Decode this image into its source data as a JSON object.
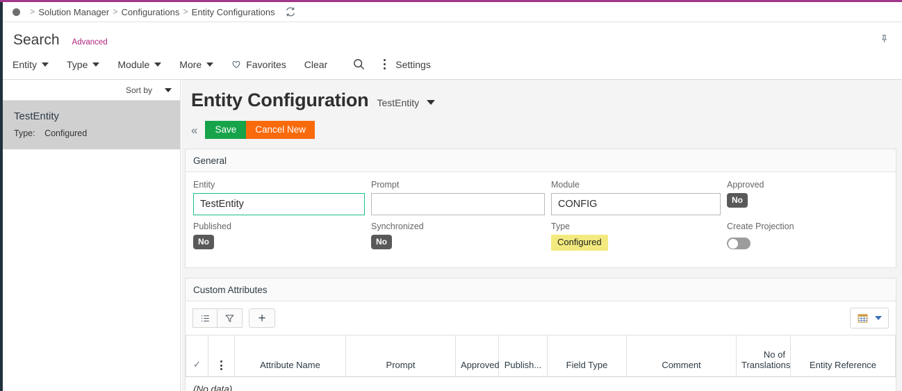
{
  "theme": {
    "accent_top_border": "#a0358a",
    "left_rail": "#20313c",
    "advanced_link": "#b0257f",
    "save_button": "#16a34a",
    "cancel_button": "#f96a0c",
    "focus_border": "#18c08f",
    "badge_no": "#595959",
    "chip_configured": "#f2ea7e",
    "selected_row": "#d0d0d0"
  },
  "breadcrumb": {
    "items": [
      "Solution Manager",
      "Configurations",
      "Entity Configurations"
    ],
    "separator": ">",
    "refresh_icon": "refresh-icon",
    "home_icon": "home-dot-icon"
  },
  "search": {
    "title": "Search",
    "advanced_label": "Advanced",
    "pin_icon": "pin-icon",
    "filters": [
      {
        "label": "Entity",
        "has_caret": true
      },
      {
        "label": "Type",
        "has_caret": true
      },
      {
        "label": "Module",
        "has_caret": true
      },
      {
        "label": "More",
        "has_caret": true
      }
    ],
    "favorites_label": "Favorites",
    "favorites_icon": "heart-icon",
    "clear_label": "Clear",
    "search_icon": "search-icon",
    "overflow_icon": "more-vertical-icon",
    "settings_label": "Settings"
  },
  "results": {
    "sort_label": "Sort by",
    "sort_caret_icon": "chevron-down-icon",
    "items": [
      {
        "name": "TestEntity",
        "meta_key": "Type:",
        "meta_value": "Configured"
      }
    ]
  },
  "page": {
    "title": "Entity Configuration",
    "subtitle": "TestEntity",
    "subtitle_caret_icon": "chevron-down-icon",
    "collapse_icon": "double-chevron-left-icon",
    "save_label": "Save",
    "cancel_label": "Cancel New"
  },
  "general": {
    "section_title": "General",
    "entity": {
      "label": "Entity",
      "value": "TestEntity",
      "placeholder": ""
    },
    "prompt": {
      "label": "Prompt",
      "value": "",
      "placeholder": ""
    },
    "module": {
      "label": "Module",
      "value": "CONFIG",
      "placeholder": ""
    },
    "approved": {
      "label": "Approved",
      "value": "No"
    },
    "published": {
      "label": "Published",
      "value": "No"
    },
    "synchronized": {
      "label": "Synchronized",
      "value": "No"
    },
    "type": {
      "label": "Type",
      "value": "Configured"
    },
    "create_projection": {
      "label": "Create Projection",
      "value": "off"
    }
  },
  "custom_attributes": {
    "section_title": "Custom Attributes",
    "toolbar": {
      "list_icon": "list-view-icon",
      "filter_icon": "filter-funnel-icon",
      "add_icon": "plus-icon",
      "grid_icon": "table-grid-icon",
      "grid_caret_icon": "chevron-down-icon"
    },
    "table": {
      "select_all_icon": "check-icon",
      "row_menu_icon": "more-vertical-icon",
      "columns": [
        "Attribute Name",
        "Prompt",
        "Approved",
        "Publish...",
        "Field Type",
        "Comment",
        "No of Translations",
        "Entity Reference"
      ],
      "empty_text": "(No data)"
    }
  }
}
